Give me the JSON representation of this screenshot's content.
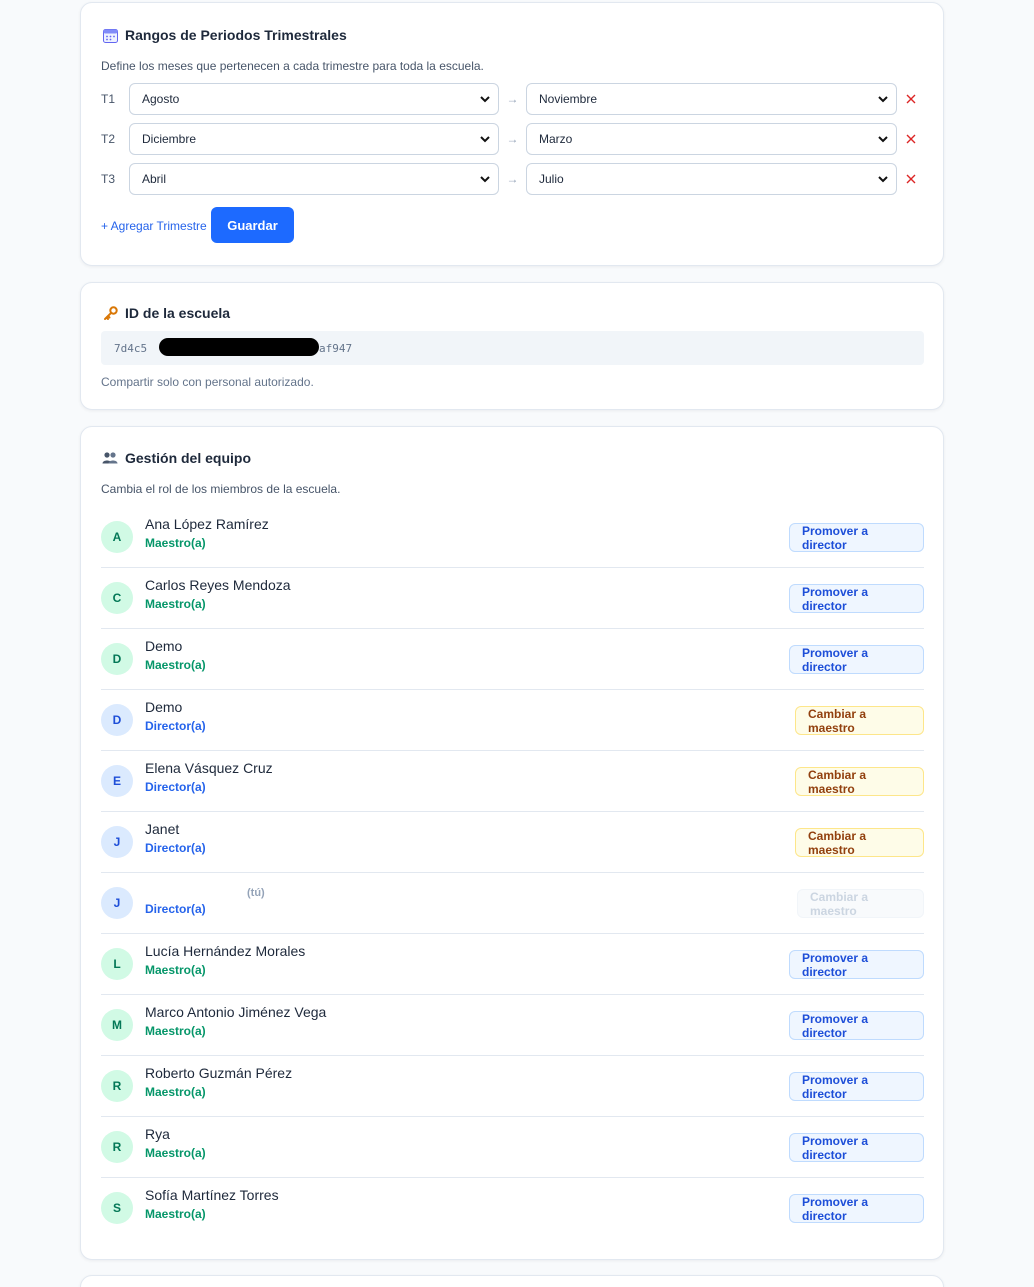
{
  "periods": {
    "title": "Rangos de Periodos Trimestrales",
    "description": "Define los meses que pertenecen a cada trimestre para toda la escuela.",
    "rows": [
      {
        "label": "T1",
        "from": "Agosto",
        "to": "Noviembre"
      },
      {
        "label": "T2",
        "from": "Diciembre",
        "to": "Marzo"
      },
      {
        "label": "T3",
        "from": "Abril",
        "to": "Julio"
      }
    ],
    "arrow": "→",
    "add_label": "+ Agregar Trimestre",
    "save_label": "Guardar"
  },
  "school_id": {
    "title": "ID de la escuela",
    "value_start": "7d4c5",
    "value_end": "af947",
    "note": "Compartir solo con personal autorizado."
  },
  "team": {
    "title": "Gestión del equipo",
    "description": "Cambia el rol de los miembros de la escuela.",
    "you_label": "(tú)",
    "members": [
      {
        "initial": "A",
        "name": "Ana López Ramírez",
        "role": "Maestro(a)",
        "action": "Promover a director"
      },
      {
        "initial": "C",
        "name": "Carlos Reyes Mendoza",
        "role": "Maestro(a)",
        "action": "Promover a director"
      },
      {
        "initial": "D",
        "name": "Demo",
        "role": "Maestro(a)",
        "action": "Promover a director"
      },
      {
        "initial": "D",
        "name": "Demo",
        "role": "Director(a)",
        "action": "Cambiar a maestro"
      },
      {
        "initial": "E",
        "name": "Elena Vásquez Cruz",
        "role": "Director(a)",
        "action": "Cambiar a maestro"
      },
      {
        "initial": "J",
        "name": "Janet",
        "role": "Director(a)",
        "action": "Cambiar a maestro"
      },
      {
        "initial": "J",
        "name": "",
        "role": "Director(a)",
        "action": "Cambiar a maestro"
      },
      {
        "initial": "L",
        "name": "Lucía Hernández Morales",
        "role": "Maestro(a)",
        "action": "Promover a director"
      },
      {
        "initial": "M",
        "name": "Marco Antonio Jiménez Vega",
        "role": "Maestro(a)",
        "action": "Promover a director"
      },
      {
        "initial": "R",
        "name": "Roberto Guzmán Pérez",
        "role": "Maestro(a)",
        "action": "Promover a director"
      },
      {
        "initial": "R",
        "name": "Rya",
        "role": "Maestro(a)",
        "action": "Promover a director"
      },
      {
        "initial": "S",
        "name": "Sofía Martínez Torres",
        "role": "Maestro(a)",
        "action": "Promover a director"
      }
    ]
  },
  "colors": {
    "primary": "#1d6aff",
    "teacher_green": "#059669",
    "director_blue": "#2563eb",
    "remove_red": "#dc2626"
  }
}
